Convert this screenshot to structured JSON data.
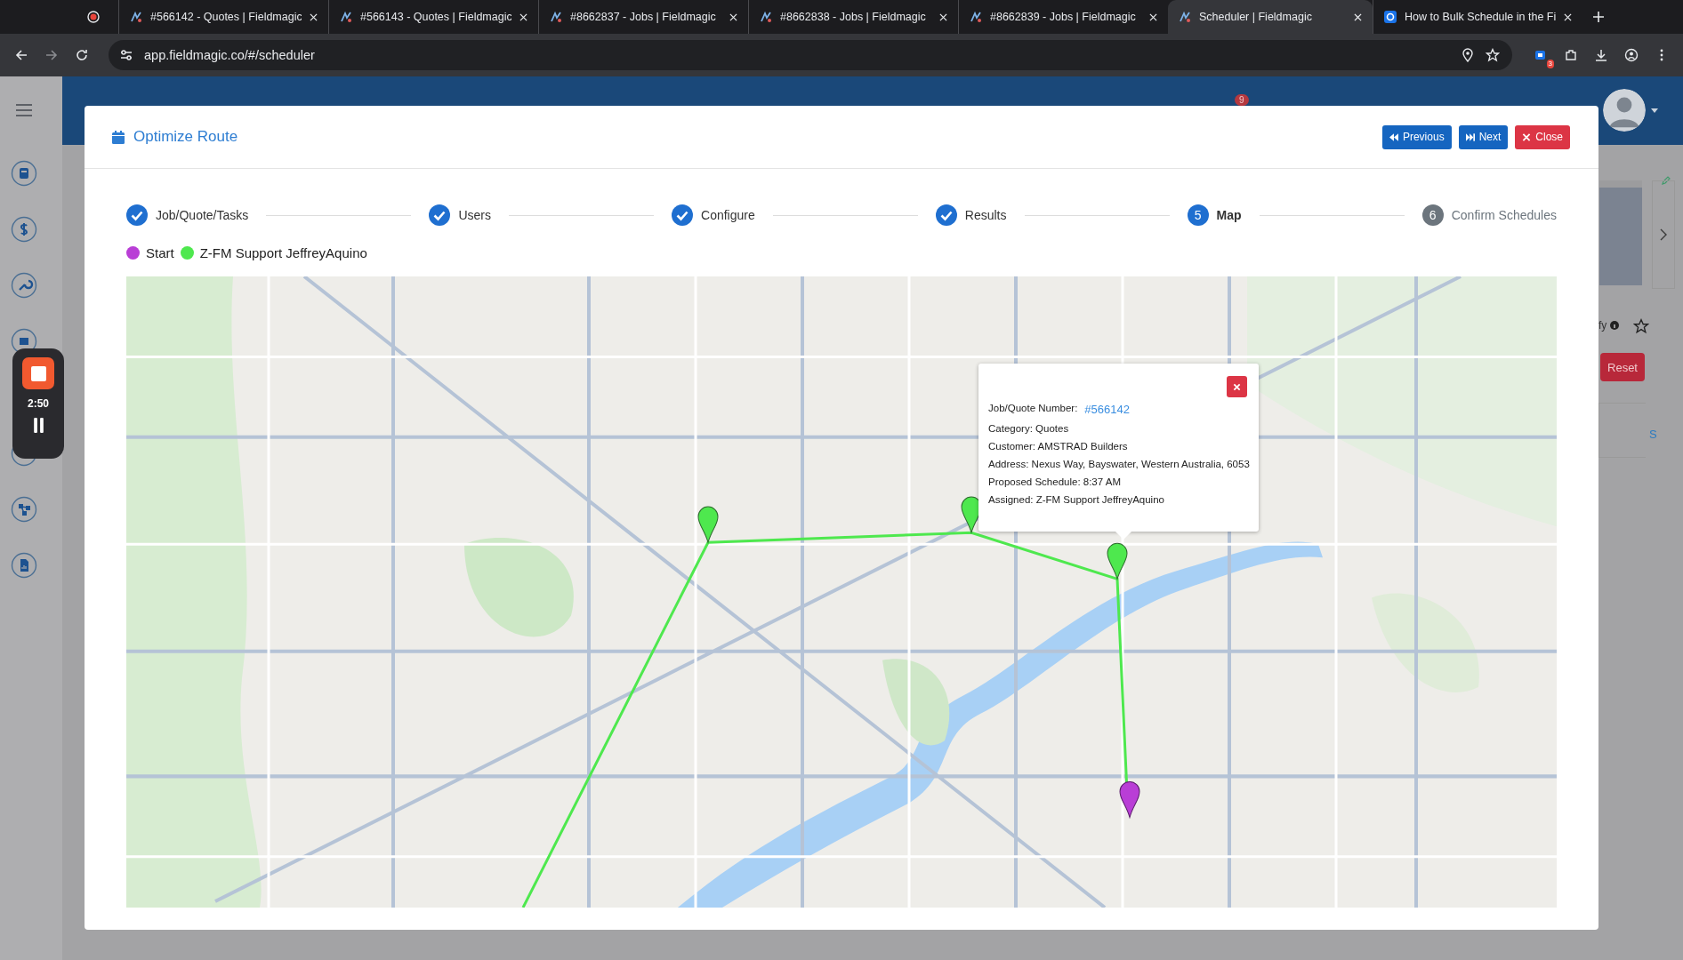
{
  "browser": {
    "tabs": [
      {
        "title": "#566142 - Quotes | Fieldmagic",
        "selected": false,
        "kind": "site"
      },
      {
        "title": "#566143 - Quotes | Fieldmagic",
        "selected": false,
        "kind": "site"
      },
      {
        "title": "#8662837 - Jobs | Fieldmagic",
        "selected": false,
        "kind": "site"
      },
      {
        "title": "#8662838 - Jobs | Fieldmagic",
        "selected": false,
        "kind": "site"
      },
      {
        "title": "#8662839 - Jobs | Fieldmagic",
        "selected": false,
        "kind": "site"
      },
      {
        "title": "Scheduler | Fieldmagic",
        "selected": true,
        "kind": "site"
      },
      {
        "title": "How to Bulk Schedule in the Fi",
        "selected": false,
        "kind": "help"
      }
    ],
    "address": "app.fieldmagic.co/#/scheduler",
    "extension_badge": "3"
  },
  "recorder": {
    "time": "2:50"
  },
  "background": {
    "notification_count": "9",
    "partial_label": "fy",
    "reset_button": "Reset",
    "partial_link": "S"
  },
  "modal": {
    "title": "Optimize Route",
    "buttons": [
      {
        "label": "Previous",
        "kind": "previous"
      },
      {
        "label": "Next",
        "kind": "next"
      },
      {
        "label": "Close",
        "kind": "close"
      }
    ],
    "steps": [
      {
        "label": "Job/Quote/Tasks",
        "completed": true,
        "selected": false
      },
      {
        "label": "Users",
        "completed": true,
        "selected": false
      },
      {
        "label": "Configure",
        "completed": true,
        "selected": false
      },
      {
        "label": "Results",
        "completed": true,
        "selected": false
      },
      {
        "label": "Map",
        "number": "5",
        "completed": false,
        "selected": true
      },
      {
        "label": "Confirm Schedules",
        "number": "6",
        "completed": false,
        "selected": false
      }
    ],
    "legend": [
      {
        "label": "Start",
        "color": "#b93ed6"
      },
      {
        "label": "Z-FM Support JeffreyAquino",
        "color": "#4ee84e"
      }
    ],
    "popup": {
      "number_label": "Job/Quote Number:",
      "number_link": "#566142",
      "lines": [
        "Category: Quotes",
        "Customer: AMSTRAD Builders",
        "Address: Nexus Way, Bayswater, Western Australia, 6053",
        "Proposed Schedule: 8:37 AM",
        "Assigned: Z-FM Support JeffreyAquino"
      ]
    }
  }
}
